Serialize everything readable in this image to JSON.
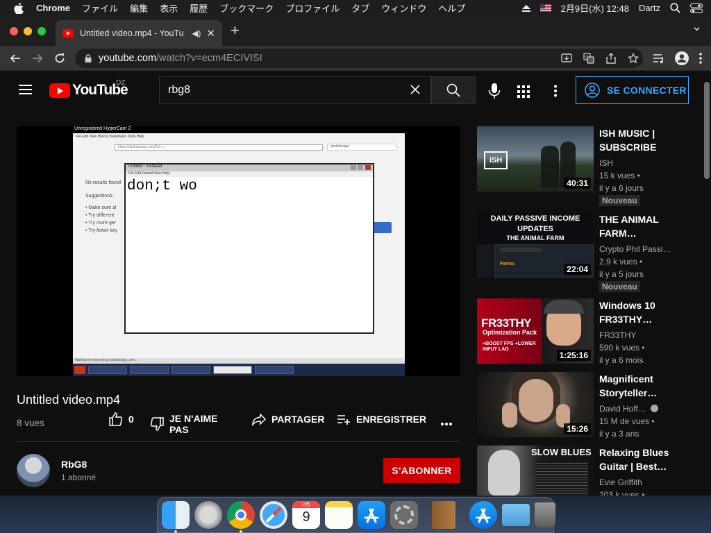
{
  "menubar": {
    "app": "Chrome",
    "items": [
      "ファイル",
      "編集",
      "表示",
      "履歴",
      "ブックマーク",
      "プロファイル",
      "タブ",
      "ウィンドウ",
      "ヘルプ"
    ],
    "datetime": "2月9日(水)  12:48",
    "user": "Dartz"
  },
  "browser": {
    "tab_title": "Untitled video.mp4 - YouTu",
    "url_domain": "youtube.com",
    "url_path": "/watch?v=ecm4ECIVISI"
  },
  "yt_header": {
    "logo_text": "YouTube",
    "country": "DZ",
    "search_value": "rbg8",
    "signin_label": "SE CONNECTER"
  },
  "video": {
    "title": "Untitled video.mp4",
    "views": "8 vues",
    "likes": "0",
    "dislike_label": "JE N'AIME PAS",
    "share_label": "PARTAGER",
    "save_label": "ENREGISTRER",
    "frame": {
      "window_title": "Unregistered HyperCam 2",
      "notepad_title": "Untitled - Notepad",
      "notepad_menu": "File   Edit   Format   View   Help",
      "notepad_text": "don;t wo",
      "page_left": [
        "No results found",
        "Suggestions:",
        "• Make sure al",
        "• Try different",
        "• Try more ger",
        "• Try fewer key"
      ],
      "status": "Waiting for improving.duckduckgo.com..."
    }
  },
  "channel": {
    "name": "RbG8",
    "subs": "1 abonné",
    "subscribe_label": "S'ABONNER"
  },
  "colors": {
    "accent_blue": "#3ea6ff",
    "subscribe_red": "#cc0000",
    "yt_red": "#ff0000",
    "bg": "#0f0f0f"
  },
  "recommendations": [
    {
      "title": "ISH MUSIC | SUBSCRIBE",
      "channel": "ISH",
      "views": "15 k vues •",
      "age": "il y a 6 jours",
      "badge": "Nouveau",
      "duration": "40:31",
      "thumb_text": "ISH"
    },
    {
      "title": "THE ANIMAL FARM…",
      "channel": "Crypto Phil Passi…",
      "views": "2,9 k vues •",
      "age": "il y a 5 jours",
      "badge": "Nouveau",
      "duration": "22:04",
      "thumb_text": "DAILY PASSIVE INCOME UPDATES",
      "thumb_sub": "THE ANIMAL FARM",
      "thumb_small": "Farms"
    },
    {
      "title": "Windows 10 FR33THY…",
      "channel": "FR33THY",
      "views": "590 k vues •",
      "age": "il y a 6 mois",
      "badge": "",
      "duration": "1:25:16",
      "thumb_text": "FR33THY",
      "thumb_sub": "Optimization Pack",
      "thumb_small": "+BOOST FPS +LOWER INPUT LAG"
    },
    {
      "title": "Magnificent Storyteller…",
      "channel": "David Hoff…",
      "views": "15 M de vues •",
      "age": "il y a 3 ans",
      "badge": "",
      "duration": "15:26",
      "verified": true
    },
    {
      "title": "Relaxing Blues Guitar | Best…",
      "channel": "Evie Griffith",
      "views": "203 k vues •",
      "age": "",
      "badge": "",
      "duration": "",
      "thumb_text": "SLOW BLUES"
    }
  ]
}
